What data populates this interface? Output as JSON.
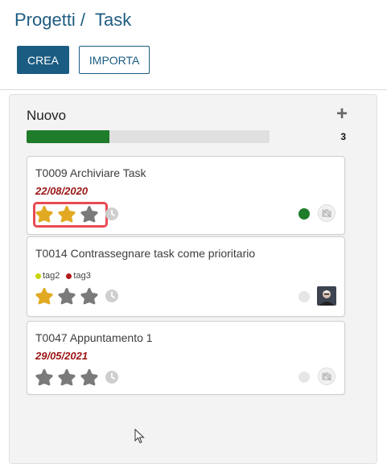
{
  "breadcrumb": {
    "parent": "Progetti",
    "separator": "/",
    "current": "Task"
  },
  "toolbar": {
    "create_label": "CREA",
    "import_label": "IMPORTA"
  },
  "column": {
    "title": "Nuovo",
    "add_symbol": "+",
    "count": "3",
    "progress_fraction": 0.34,
    "progress_color": "#1e7c2a"
  },
  "colors": {
    "accent": "#1b5c82",
    "star_on": "#e2a923",
    "star_off": "#7a7a7a",
    "date": "#9a1515",
    "highlight": "#e84a55"
  },
  "cards": [
    {
      "title": "T0009 Archiviare Task",
      "date": "22/08/2020",
      "rating": 2,
      "status_color": "#1e7c2a",
      "highlighted": true
    },
    {
      "title": "T0014 Contrassegnare task come prioritario",
      "tags": [
        {
          "label": "tag2",
          "color": "#c8d40a"
        },
        {
          "label": "tag3",
          "color": "#b21a1a"
        }
      ],
      "rating": 1,
      "status_color": "#e6e6e6"
    },
    {
      "title": "T0047 Appuntamento 1",
      "date": "29/05/2021",
      "rating": 0,
      "status_color": "#e6e6e6"
    }
  ]
}
